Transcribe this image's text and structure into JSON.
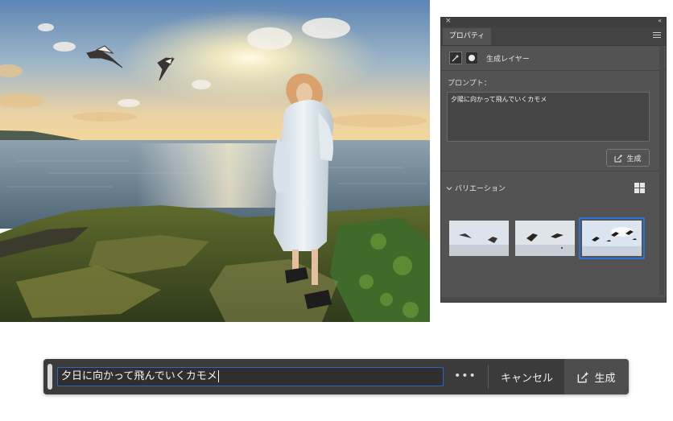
{
  "panel": {
    "close_glyph": "×",
    "collapse_glyph": "«",
    "tab_label": "プロパティ",
    "menu_icon": "hamburger-icon",
    "layer_icon": "generative-sparkle-icon",
    "mask_icon": "layer-mask-icon",
    "layer_label": "生成レイヤー",
    "prompt_label": "プロンプト：",
    "prompt_value": "夕陽に向かって飛んでいくカモメ",
    "generate_label": "生成",
    "variations_label": "バリエーション",
    "variations_selected": 3
  },
  "taskbar": {
    "prompt_value": "夕日に向かって飛んでいくカモメ",
    "more_label": "•••",
    "cancel_label": "キャンセル",
    "generate_label": "生成"
  },
  "colors": {
    "panel_bg": "#535353",
    "taskbar_bg": "#3b3b3b",
    "accent_blue": "#2b6fd8"
  }
}
